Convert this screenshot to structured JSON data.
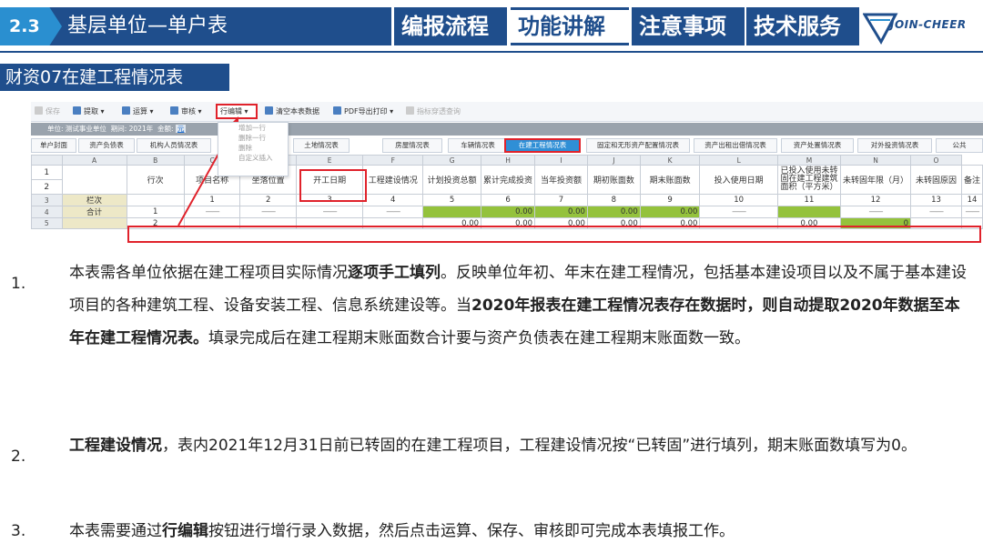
{
  "header": {
    "badge": "2.3",
    "title": "基层单位—单户表",
    "nav": [
      "编报流程",
      "功能讲解",
      "注意事项",
      "技术服务"
    ],
    "logo_text": "JOIN-CHEER",
    "accent": "#1f4e8c"
  },
  "section_title": "财资07在建工程情况表",
  "app": {
    "toolbar": [
      {
        "label": "保存",
        "icon": "save-icon",
        "disabled": true
      },
      {
        "label": "提取",
        "icon": "extract-icon"
      },
      {
        "label": "运算",
        "icon": "calc-icon"
      },
      {
        "label": "审核",
        "icon": "check-icon"
      },
      {
        "label": "行编辑",
        "highlight": true
      },
      {
        "label": "清空本表数据",
        "icon": "clear-icon"
      },
      {
        "label": "PDF导出打印",
        "icon": "pdf-icon"
      },
      {
        "label": "指标穿透查询",
        "icon": "query-icon",
        "disabled": true
      }
    ],
    "infobar": {
      "unit_label": "单位:",
      "unit_value": "测试事业单位",
      "period_label": "期间:",
      "period_value": "2021年",
      "currency_label": "金额:",
      "currency_value": "元"
    },
    "dropdown": [
      "增加一行",
      "删除一行",
      "删除",
      "自定义插入"
    ],
    "tabs": [
      "单户封面",
      "资产负债表",
      "机构人员情况表",
      "土地情况表",
      "房屋情况表",
      "车辆情况表",
      "在建工程情况表",
      "固定和无形资产配置情况表",
      "资产出租出借情况表",
      "资产处置情况表",
      "对外投资情况表",
      "公共"
    ],
    "active_tab": "在建工程情况表",
    "col_letters": [
      "A",
      "B",
      "C",
      "D",
      "E",
      "F",
      "G",
      "H",
      "I",
      "J",
      "K",
      "L",
      "M",
      "N",
      "O",
      "P"
    ],
    "col_headers": [
      "",
      "行次",
      "项目名称",
      "坐落位置",
      "开工日期",
      "工程建设情况",
      "计划投资总额",
      "累计完成投资",
      "当年投资额",
      "期初账面数",
      "期末账面数",
      "投入使用日期",
      "已投入使用未转固在建工程建筑面积（平方米）",
      "未转固年限（月）",
      "未转固原因",
      "备注"
    ],
    "row_numbers": [
      "1",
      "2",
      "3",
      "4",
      "5"
    ],
    "row3": [
      "栏次",
      "",
      "1",
      "2",
      "3",
      "4",
      "5",
      "6",
      "7",
      "8",
      "9",
      "10",
      "11",
      "12",
      "13",
      "14"
    ],
    "row4": [
      "合计",
      "1",
      "——",
      "——",
      "——",
      "——",
      "",
      "0.00",
      "0.00",
      "0.00",
      "0.00",
      "——",
      "",
      "——",
      "——",
      "——"
    ],
    "row5": [
      "",
      "2",
      "",
      "",
      "",
      "",
      "0.00",
      "0.00",
      "0.00",
      "0.00",
      "0.00",
      "",
      "0.00",
      "0",
      "",
      ""
    ],
    "green": "#94c23c",
    "highlight_red": "#e0222b"
  },
  "paragraphs": [
    {
      "num": "1.",
      "parts": [
        {
          "t": "本表需各单位依据在建工程项目实际情况",
          "b": false
        },
        {
          "t": "逐项手工填列",
          "b": true
        },
        {
          "t": "。反映单位年初、年末在建工程情况，包括基本建设项目以及不属于基本建设项目的各种建筑工程、设备安装工程、信息系统建设等。当",
          "b": false
        },
        {
          "t": "2020年报表在建工程情况表存在数据时，则自动提取2020年数据至本年在建工程情况表。",
          "b": true
        },
        {
          "t": "填录完成后在建工程期末账面数合计要与资产负债表在建工程期末账面数一致。",
          "b": false
        }
      ]
    },
    {
      "num": "2.",
      "parts": [
        {
          "t": "工程建设情况",
          "b": true
        },
        {
          "t": "，表内2021年12月31日前已转固的在建工程项目，工程建设情况按“已转固”进行填列，期末账面数填写为0。",
          "b": false
        }
      ]
    },
    {
      "num": "3.",
      "parts": [
        {
          "t": "本表需要通过",
          "b": false
        },
        {
          "t": "行编辑",
          "b": true
        },
        {
          "t": "按钮进行增行录入数据，然后点击运算、保存、审核即可完成本表填报工作。",
          "b": false
        }
      ]
    }
  ]
}
